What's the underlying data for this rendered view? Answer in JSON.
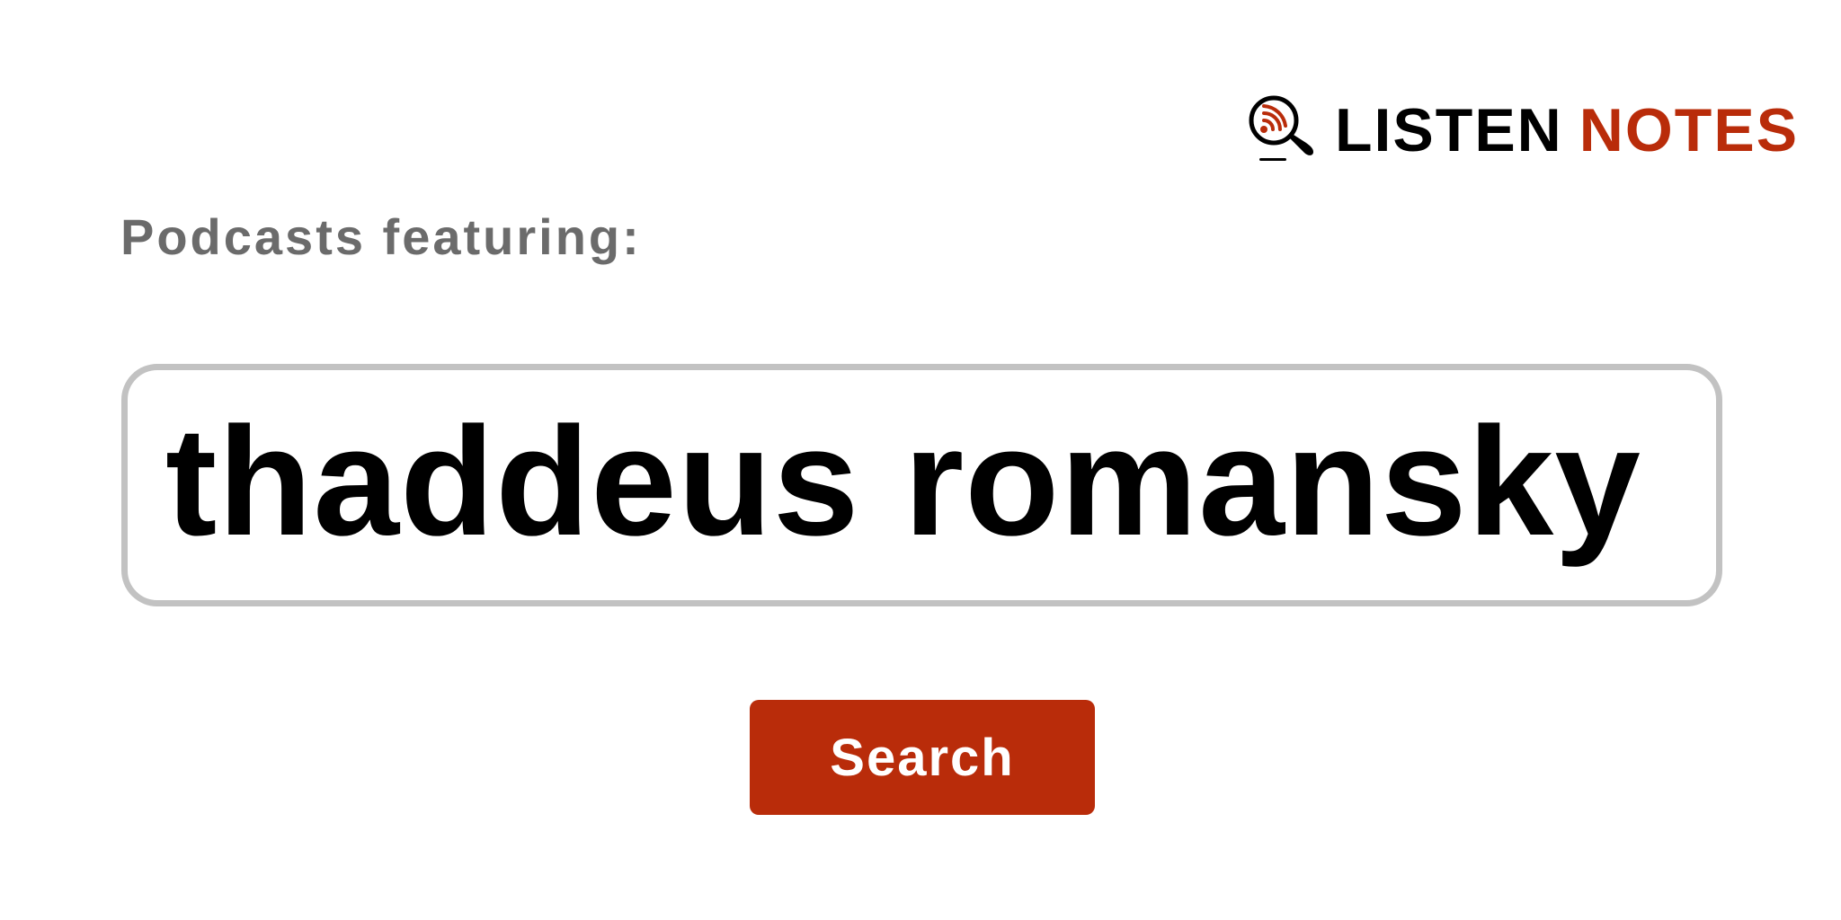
{
  "logo": {
    "word1": "LISTEN",
    "word2": "NOTES",
    "icon": "podcast-search-icon"
  },
  "subtitle": "Podcasts featuring:",
  "search": {
    "value": "thaddeus romansky"
  },
  "search_button": {
    "label": "Search"
  },
  "colors": {
    "brand": "#b92c0a",
    "text_dark": "#000000",
    "text_muted": "#6b6b6b",
    "input_border": "#c2c2c2",
    "background": "#ffffff"
  }
}
